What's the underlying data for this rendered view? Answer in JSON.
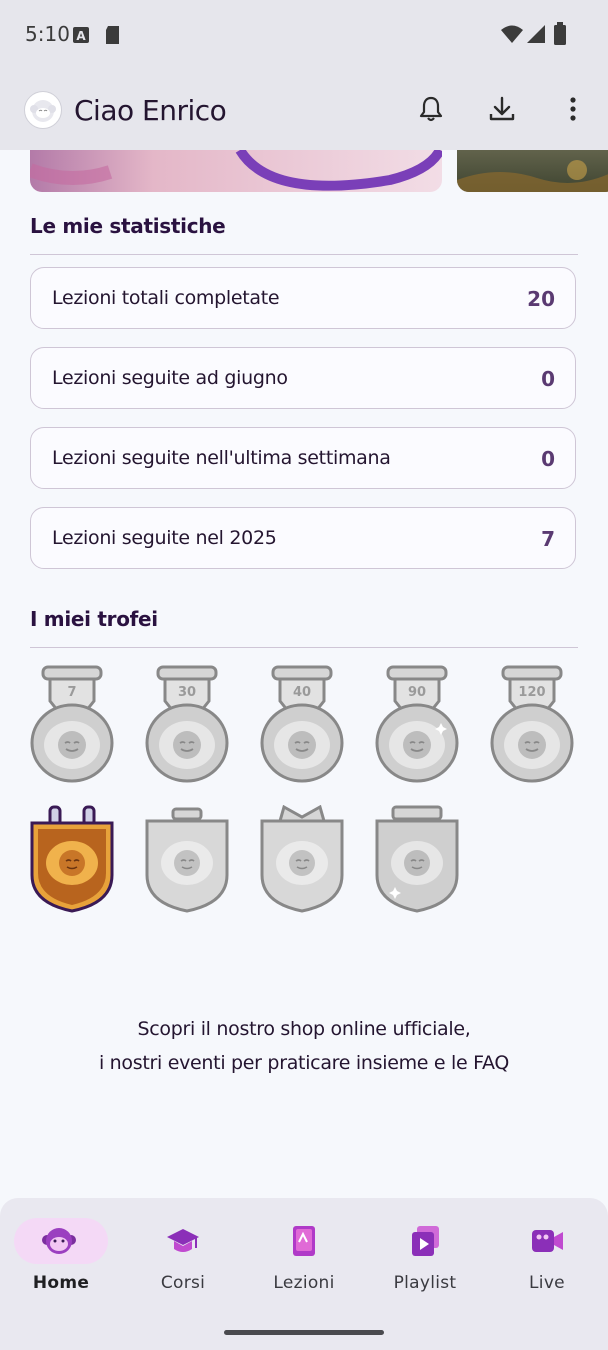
{
  "status_bar": {
    "time": "5:10",
    "icons": [
      "a-icon",
      "sd-card-icon",
      "wifi-icon",
      "signal-icon",
      "battery-icon"
    ]
  },
  "header": {
    "greeting": "Ciao Enrico",
    "icons": [
      "bell-icon",
      "download-icon",
      "more-vert-icon"
    ]
  },
  "stats": {
    "title": "Le mie statistiche",
    "items": [
      {
        "label": "Lezioni totali completate",
        "value": "20"
      },
      {
        "label": "Lezioni seguite ad giugno",
        "value": "0"
      },
      {
        "label": "Lezioni seguite nell'ultima settimana",
        "value": "0"
      },
      {
        "label": "Lezioni seguite nel 2025",
        "value": "7"
      }
    ]
  },
  "trophies": {
    "title": "I miei trofei",
    "streak_medals": [
      "7",
      "30",
      "40",
      "90",
      "120"
    ],
    "badges_unlocked": [
      true,
      false,
      false,
      false
    ]
  },
  "footer": {
    "line1": "Scopri il nostro shop online ufficiale,",
    "line2": "i nostri eventi per praticare insieme e le FAQ"
  },
  "nav": {
    "items": [
      {
        "label": "Home",
        "icon": "monkey-icon",
        "active": true
      },
      {
        "label": "Corsi",
        "icon": "graduation-cap-icon",
        "active": false
      },
      {
        "label": "Lezioni",
        "icon": "book-icon",
        "active": false
      },
      {
        "label": "Playlist",
        "icon": "playlist-icon",
        "active": false
      },
      {
        "label": "Live",
        "icon": "video-camera-icon",
        "active": false
      }
    ]
  },
  "colors": {
    "accent": "#5a3a72",
    "nav_active_pill": "#f4d9f6",
    "badge_gold": "#e8a23a"
  }
}
